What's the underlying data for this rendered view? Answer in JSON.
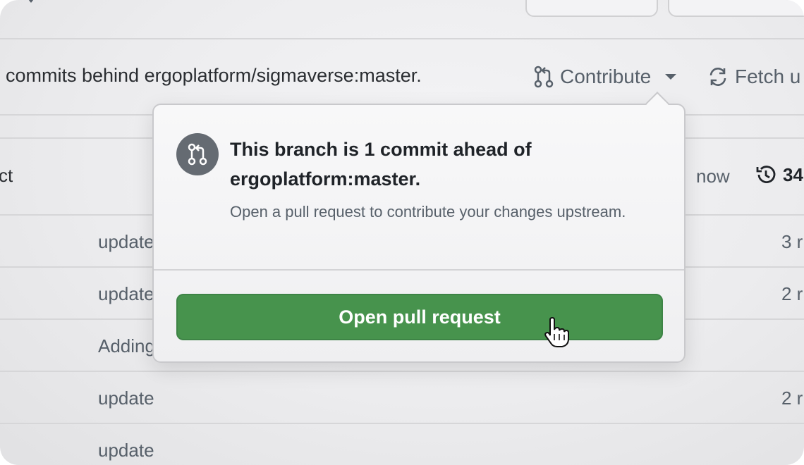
{
  "banner": {
    "text": "commits behind ergoplatform/sigmaverse:master.",
    "contribute_label": "Contribute",
    "fetch_label": "Fetch u"
  },
  "table": {
    "header": {
      "left_text": "ct",
      "updated": "now",
      "commit_count": "34"
    },
    "rows": [
      {
        "message": "update",
        "age": "3 r"
      },
      {
        "message": "update",
        "age": "2 r"
      },
      {
        "message": "Adding",
        "age": ""
      },
      {
        "message": "update",
        "age": "2 r"
      },
      {
        "message": "update",
        "age": ""
      }
    ]
  },
  "popover": {
    "title": "This branch is 1 commit ahead of ergoplatform:master.",
    "description": "Open a pull request to contribute your changes upstream.",
    "button_label": "Open pull request"
  },
  "colors": {
    "accent_green": "#47934d",
    "icon_circle": "#656b72",
    "muted_text": "#57606a"
  },
  "icons": [
    "git-pull-request-icon",
    "chevron-down-icon",
    "sync-icon",
    "history-icon",
    "hand-pointer-cursor-icon"
  ]
}
